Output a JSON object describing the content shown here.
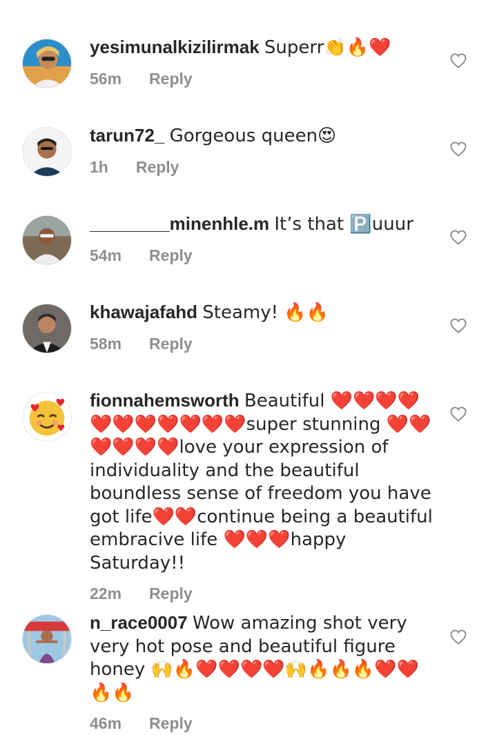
{
  "comments": [
    {
      "username": "yesimunalkizilirmak",
      "text": "Superr👏🔥❤️",
      "time": "56m",
      "reply_label": "Reply"
    },
    {
      "username": "tarun72_",
      "text": "Gorgeous queen😍",
      "time": "1h",
      "reply_label": "Reply"
    },
    {
      "username": "________minenhle.m",
      "text": "It’s that 🅿️uuur",
      "time": "54m",
      "reply_label": "Reply"
    },
    {
      "username": "khawajafahd",
      "text": "Steamy! 🔥🔥",
      "time": "58m",
      "reply_label": "Reply"
    },
    {
      "username": "fionnahemsworth",
      "text": "Beautiful ❤️❤️❤️❤️❤️❤️❤️❤️❤️❤️❤️super stunning ❤️❤️❤️❤️❤️❤️love your expression of individuality and the beautiful boundless sense of freedom you have got life❤️❤️continue being a beautiful embracive life ❤️❤️❤️happy Saturday!!",
      "time": "22m",
      "reply_label": "Reply"
    },
    {
      "username": "n_race0007",
      "text": "Wow amazing shot very very hot pose and beautiful figure honey 🙌🔥❤️❤️❤️❤️🙌🔥🔥🔥❤️❤️🔥🔥",
      "time": "46m",
      "reply_label": "Reply"
    }
  ],
  "icons": {
    "like": "heart-outline-icon",
    "avatar_emoji": "smiling-face-with-hearts-emoji"
  },
  "colors": {
    "text": "#262626",
    "meta": "#8e8e8e",
    "icon": "#8e8e8e"
  }
}
